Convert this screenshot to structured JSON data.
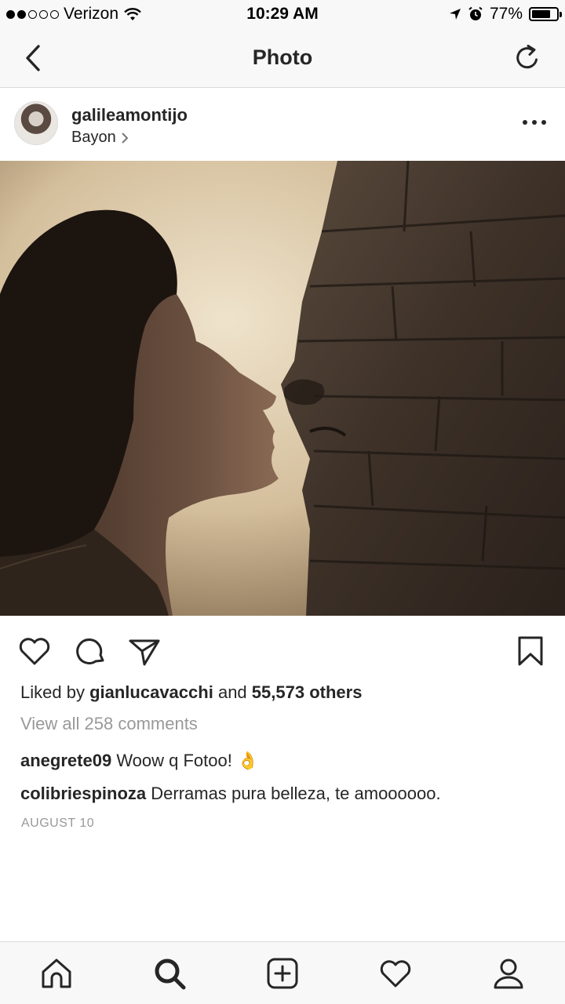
{
  "status_bar": {
    "carrier": "Verizon",
    "time": "10:29 AM",
    "battery": "77%",
    "battery_level": 0.77,
    "signal_bars_filled": 2,
    "signal_bars_total": 5
  },
  "nav": {
    "title": "Photo",
    "back_icon": "chevron-left-icon",
    "refresh_icon": "refresh-icon"
  },
  "post": {
    "username": "galileamontijo",
    "location": "Bayon",
    "likes": {
      "prefix": "Liked by",
      "user": "gianlucavacchi",
      "joiner": "and",
      "others": "55,573 others"
    },
    "view_comments": "View all 258 comments",
    "comments": [
      {
        "user": "anegrete09",
        "text": "Woow q Fotoo! 👌"
      },
      {
        "user": "colibriespinoza",
        "text": "Derramas pura belleza, te amoooooo."
      }
    ],
    "date": "AUGUST 10"
  },
  "tab_bar": {
    "items": [
      "home-icon",
      "search-icon",
      "add-post-icon",
      "activity-heart-icon",
      "profile-icon"
    ],
    "active": "search-icon"
  }
}
